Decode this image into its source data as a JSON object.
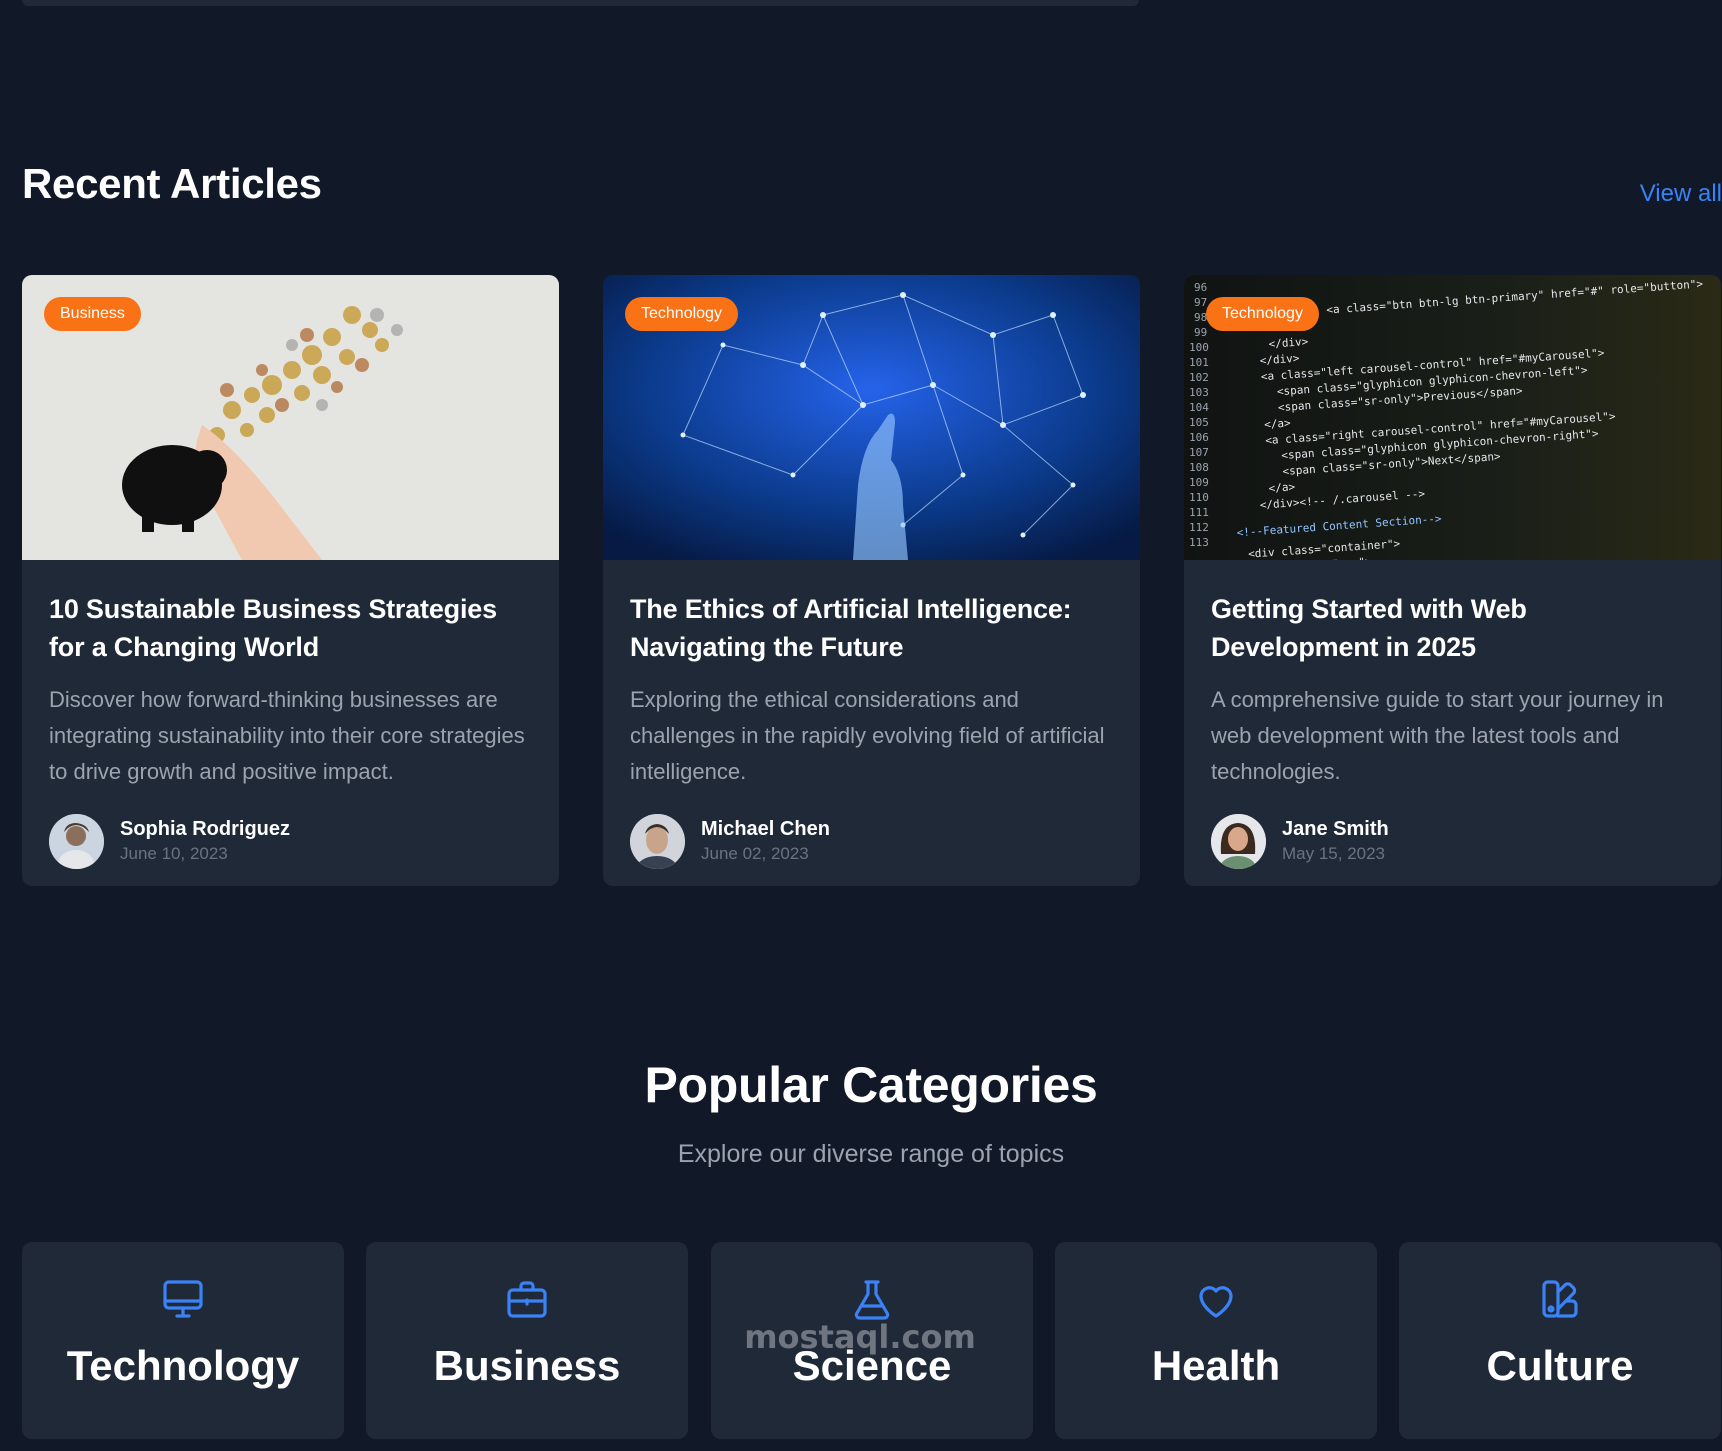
{
  "recent": {
    "title": "Recent Articles",
    "view_all": "View all"
  },
  "articles": [
    {
      "category": "Business",
      "title": "10 Sustainable Business Strategies for a Changing World",
      "excerpt": "Discover how forward-thinking businesses are integrating sustainability into their core strategies to drive growth and positive impact.",
      "author": "Sophia Rodriguez",
      "date": "June 10, 2023",
      "image": "piggy-bank-coins"
    },
    {
      "category": "Technology",
      "title": "The Ethics of Artificial Intelligence: Navigating the Future",
      "excerpt": "Exploring the ethical considerations and challenges in the rapidly evolving field of artificial intelligence.",
      "author": "Michael Chen",
      "date": "June 02, 2023",
      "image": "ai-network-hand"
    },
    {
      "category": "Technology",
      "title": "Getting Started with Web Development in 2025",
      "excerpt": "A comprehensive guide to start your journey in web development with the latest tools and technologies.",
      "author": "Jane Smith",
      "date": "May 15, 2023",
      "image": "code-on-screen"
    }
  ],
  "categories_section": {
    "title": "Popular Categories",
    "subtitle": "Explore our diverse range of topics"
  },
  "categories": [
    {
      "label": "Technology",
      "icon": "monitor-icon"
    },
    {
      "label": "Business",
      "icon": "briefcase-icon"
    },
    {
      "label": "Science",
      "icon": "flask-icon"
    },
    {
      "label": "Health",
      "icon": "heart-icon"
    },
    {
      "label": "Culture",
      "icon": "palette-icon"
    }
  ],
  "watermark": {
    "text": "mostaql.com"
  },
  "colors": {
    "background": "#111827",
    "card": "#1f2937",
    "accent": "#f97316",
    "link": "#3b82f6",
    "icon": "#3b82f6",
    "muted": "#9ca3af"
  }
}
